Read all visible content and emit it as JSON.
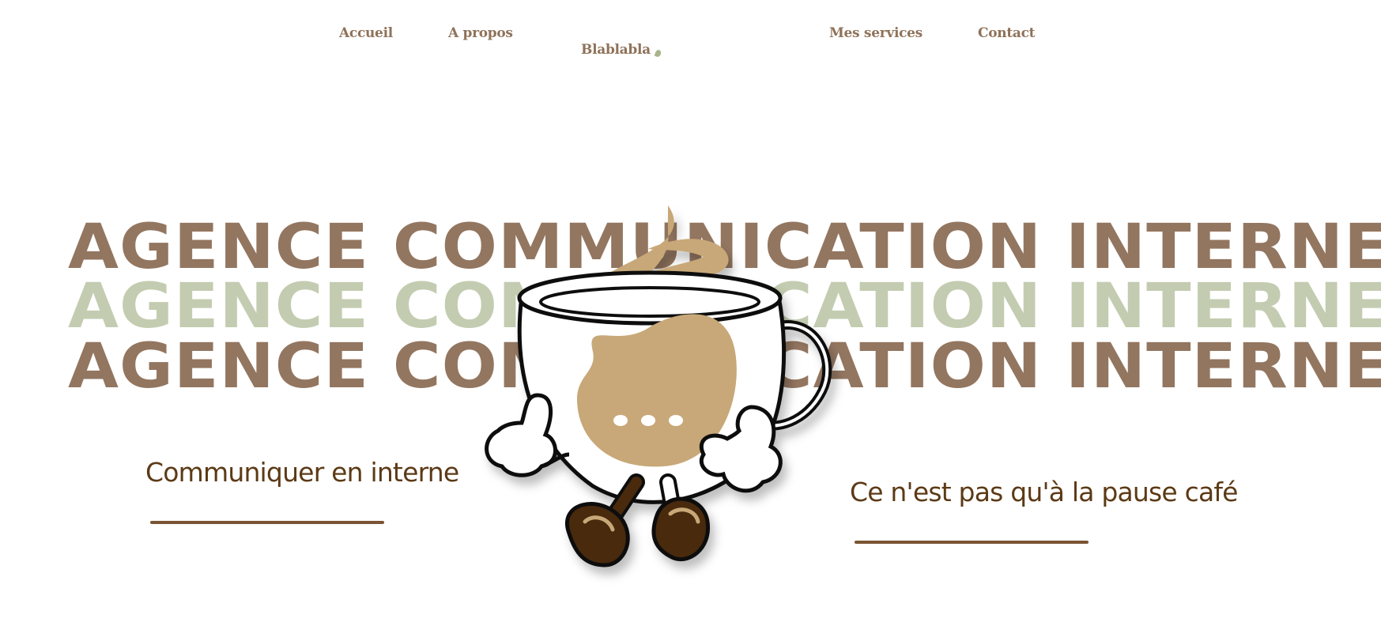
{
  "nav": {
    "links": [
      "Accueil",
      "A propos",
      "Mes services",
      "Contact"
    ],
    "logo": "Blablabla"
  },
  "hero": {
    "headlines": [
      "AGENCE COMMUNICATION INTERNE",
      "AGENCE COMMUNICATION INTERNE",
      "AGENCE COMMUNICATION INTERNE"
    ],
    "mascot_icon": "coffee-cup-mascot-icon",
    "bubble_text": "..."
  },
  "taglines": {
    "left": "Communiquer en interne",
    "right": "Ce n'est pas qu'à la pause café"
  },
  "colors": {
    "brown": "#937660",
    "sage": "#c3ccb0",
    "logo_green": "#a9b48a",
    "dark_brown": "#5c3a16",
    "latte": "#c8a878"
  }
}
